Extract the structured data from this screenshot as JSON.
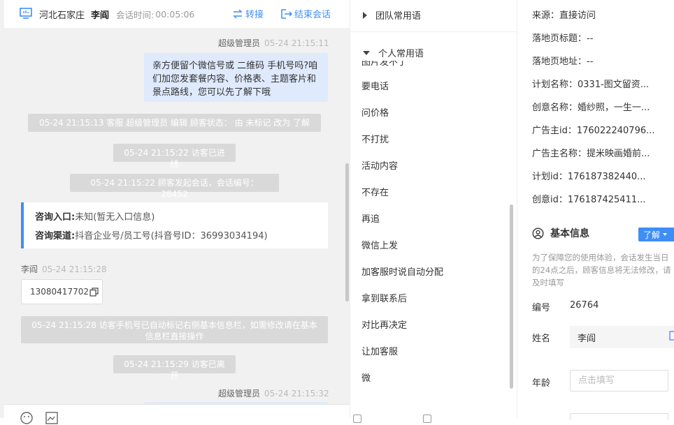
{
  "header": {
    "location": "河北石家庄",
    "visitor_name": "李阎",
    "session_time_label": "会话时间:",
    "session_time": "00:05:06",
    "transfer_label": "转接",
    "end_label": "结束会话"
  },
  "messages": {
    "m1_sender": "超级管理员",
    "m1_time": "05-24 21:15:11",
    "m1_text": "亲方便留个微信号或 二维码 手机号吗?咱们加您发套餐内容、价格表、主题客片和景点路线，您可以先了解下哦",
    "s1": "05-24 21:15:13 客服 超级管理员 编辑 顾客状态： 由 未标记 改为 了解",
    "s2": "05-24 21:15:22 访客已进线",
    "s3": "05-24 21:15:22 顾客发起会话，会话编号：28452",
    "card_entry_label": "咨询入口:",
    "card_entry_value": "未知(暂无入口信息)",
    "card_channel_label": "咨询渠道:",
    "card_channel_value": "抖音企业号/员工号(抖音号ID：36993034194)",
    "v1_sender": "李阎",
    "v1_time": "05-24 21:15:28",
    "v1_phone": "13080417702",
    "s4": "05-24 21:15:28 访客手机号已自动标记右侧基本信息栏，如需修改请在基本信息栏直接操作",
    "s5": "05-24 21:15:29 访客已离开",
    "m2_sender": "超级管理员",
    "m2_time": "05-24 21:15:32"
  },
  "phrases": {
    "team_group": "团队常用语",
    "personal_group": "个人常用语",
    "items": [
      "要电话",
      "问价格",
      "不打扰",
      "活动内容",
      "不存在",
      "再追",
      "微信上发",
      "加客服时说自动分配",
      "拿到联系后",
      "对比再决定",
      "让加客服",
      "微"
    ]
  },
  "info": {
    "source": "来源：直接访问",
    "landing_title": "落地页标题：--",
    "landing_url": "落地页地址：--",
    "plan_name": "计划名称：0331-图文留资...",
    "creative_name": "创意名称：婚纱照，一生一...",
    "advertiser_id": "广告主id：176022240796...",
    "advertiser_name": "广告主名称：提米映画婚前...",
    "plan_id": "计划id：176187382440...",
    "creative_id": "创意id：176187425411...",
    "basic_title": "基本信息",
    "learn_label": "了解",
    "notice": "为了保障您的使用体验，会话发生当日的24点之后，顾客信息将无法修改，请及时填写",
    "number_label": "编号",
    "number_value": "26764",
    "name_label": "姓名",
    "name_value": "李阎",
    "age_label": "年龄",
    "age_placeholder": "点击填写"
  },
  "colors": {
    "accent": "#3e8ef7",
    "bubble": "#dfeafd",
    "system": "#d9d9d9"
  }
}
